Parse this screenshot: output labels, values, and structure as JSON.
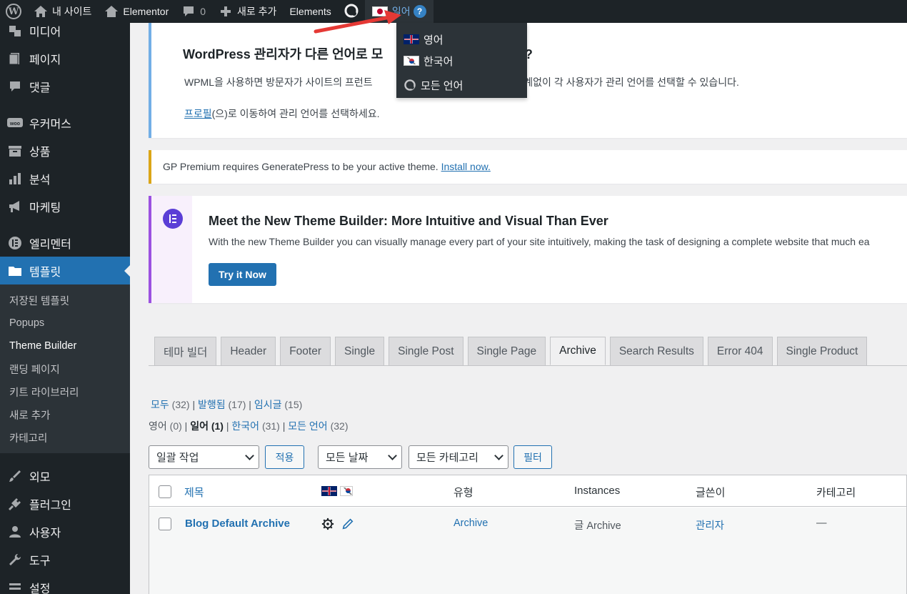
{
  "adminbar": {
    "site_name": "내 사이트",
    "elementor": "Elementor",
    "comments_count": "0",
    "new_label": "새로 추가",
    "elements": "Elements",
    "current_lang": "일어",
    "help": "?"
  },
  "lang_dropdown": {
    "items": [
      {
        "label": "영어",
        "flag": "gb"
      },
      {
        "label": "한국어",
        "flag": "kr"
      },
      {
        "label": "모든 언어",
        "flag": "all"
      }
    ]
  },
  "sidebar": {
    "items": [
      {
        "label": "미디어",
        "icon": "media-icon"
      },
      {
        "label": "페이지",
        "icon": "page-icon"
      },
      {
        "label": "댓글",
        "icon": "comment-icon"
      },
      {
        "label": "우커머스",
        "icon": "woo-icon"
      },
      {
        "label": "상품",
        "icon": "archive-icon"
      },
      {
        "label": "분석",
        "icon": "chart-icon"
      },
      {
        "label": "마케팅",
        "icon": "megaphone-icon"
      },
      {
        "label": "엘리멘터",
        "icon": "elementor-icon"
      },
      {
        "label": "템플릿",
        "icon": "folder-icon"
      }
    ],
    "submenu": [
      "저장된 템플릿",
      "Popups",
      "Theme Builder",
      "랜딩 페이지",
      "키트 라이브러리",
      "새로 추가",
      "카테고리"
    ],
    "bottom_items": [
      {
        "label": "외모",
        "icon": "brush-icon"
      },
      {
        "label": "플러그인",
        "icon": "plugin-icon"
      },
      {
        "label": "사용자",
        "icon": "user-icon"
      },
      {
        "label": "도구",
        "icon": "wrench-icon"
      },
      {
        "label": "설정",
        "icon": "settings-icon"
      }
    ]
  },
  "wpml_notice": {
    "title_a": "WordPress 관리자가 다른 언어로 ",
    "title_b": "모",
    "title_c": "요?",
    "line1_a": "WPML을 사용하면 방문자가 사이트의 프런트",
    "line1_b": "와 관계없이 각 사용자가 관리 언어를 선택할 수 있습니다.",
    "line2_link": "프로필",
    "line2_rest": "(으)로 이동하여 관리 언어를 선택하세요."
  },
  "gp_notice": {
    "text": "GP Premium requires GeneratePress to be your active theme. ",
    "link": "Install now."
  },
  "elementor_notice": {
    "logo": "E",
    "title": "Meet the New Theme Builder: More Intuitive and Visual Than Ever",
    "body": "With the new Theme Builder you can visually manage every part of your site intuitively, making the task of designing a complete website that much ea",
    "button": "Try it Now"
  },
  "tabs": [
    "테마 빌더",
    "Header",
    "Footer",
    "Single",
    "Single Post",
    "Single Page",
    "Archive",
    "Search Results",
    "Error 404",
    "Single Product"
  ],
  "active_tab": "Archive",
  "status_filter": {
    "all": "모두",
    "all_count": "(32)",
    "published": "발행됨",
    "published_count": "(17)",
    "draft": "임시글",
    "draft_count": "(15)"
  },
  "lang_filter": {
    "en": "영어",
    "en_count": "(0)",
    "ja": "일어",
    "ja_count": "(1)",
    "ko": "한국어",
    "ko_count": "(31)",
    "all": "모든 언어",
    "all_count": "(32)"
  },
  "controls": {
    "bulk": "일괄 작업",
    "apply": "적용",
    "dates": "모든 날짜",
    "categories": "모든 카테고리",
    "filter": "필터"
  },
  "table": {
    "headers": {
      "title": "제목",
      "type": "유형",
      "instances": "Instances",
      "author": "글쓴이",
      "category": "카테고리"
    },
    "rows": [
      {
        "title": "Blog Default Archive",
        "type": "Archive",
        "instances": "글 Archive",
        "author": "관리자",
        "category": "—"
      }
    ]
  }
}
